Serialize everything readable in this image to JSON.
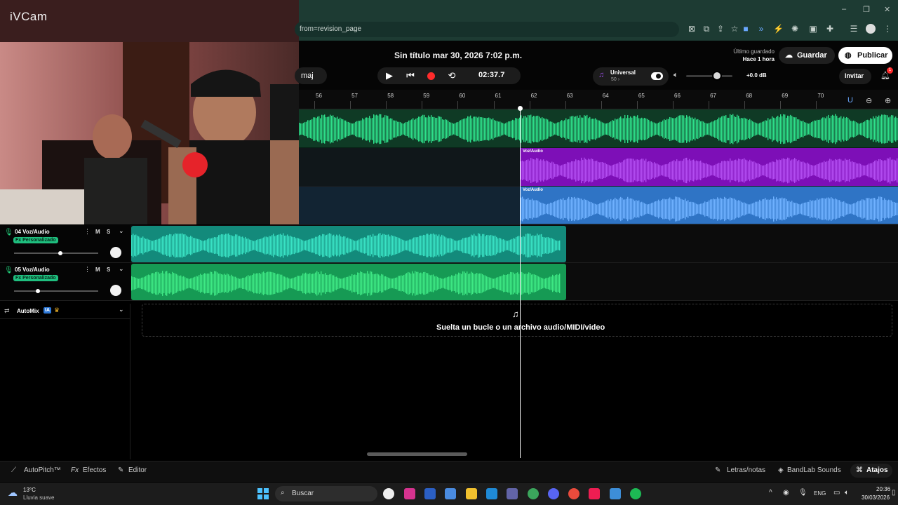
{
  "webcam": {
    "label": "iVCam"
  },
  "browser": {
    "url": "from=revision_page",
    "window_controls": [
      "–",
      "❐",
      "✕"
    ]
  },
  "header": {
    "doc_title": "Sin título mar 30, 2026 7:02 p.m.",
    "key_label": "maj",
    "timecode": "02:37.7",
    "preset_name": "Universal",
    "preset_sub": "50 ›",
    "gain": "+0.0 dB",
    "last_saved_label": "Último guardado",
    "last_saved_time": "Hace 1 hora",
    "save_label": "Guardar",
    "publish_label": "Publicar",
    "invite_label": "Invitar",
    "notif_count": "1"
  },
  "ruler": {
    "bars": [
      "56",
      "57",
      "58",
      "59",
      "60",
      "61",
      "62",
      "63",
      "64",
      "65",
      "66",
      "67",
      "68",
      "69",
      "70"
    ]
  },
  "clips": {
    "purple_label": "Voz/Audio",
    "blue_label": "Voz/Audio"
  },
  "tracks": [
    {
      "name": "04  Voz/Audio",
      "fx": "Fx Personalizado",
      "mute": "M",
      "solo": "S",
      "pan": 0.55
    },
    {
      "name": "05  Voz/Audio",
      "fx": "Fx Personalizado",
      "mute": "M",
      "solo": "S",
      "pan": 0.28
    }
  ],
  "automix": {
    "label": "AutoMix",
    "badge": "IA"
  },
  "drop_zone": {
    "text": "Suelta un bucle o un archivo audio/MIDI/video"
  },
  "bottom_bar": {
    "autopitch": "AutoPitch™",
    "effects": "Efectos",
    "editor": "Editor",
    "lyrics": "Letras/notas",
    "sounds": "BandLab Sounds",
    "shortcuts": "Atajos"
  },
  "taskbar": {
    "weather_temp": "13°C",
    "weather_desc": "Lluvia suave",
    "search_placeholder": "Buscar",
    "lang": "ENG",
    "time": "20:36",
    "date": "30/03/2026"
  },
  "colors": {
    "green": "#22d67e",
    "purple": "#8a16c9",
    "blue": "#3b82d6",
    "teal": "#1fc7a9"
  }
}
